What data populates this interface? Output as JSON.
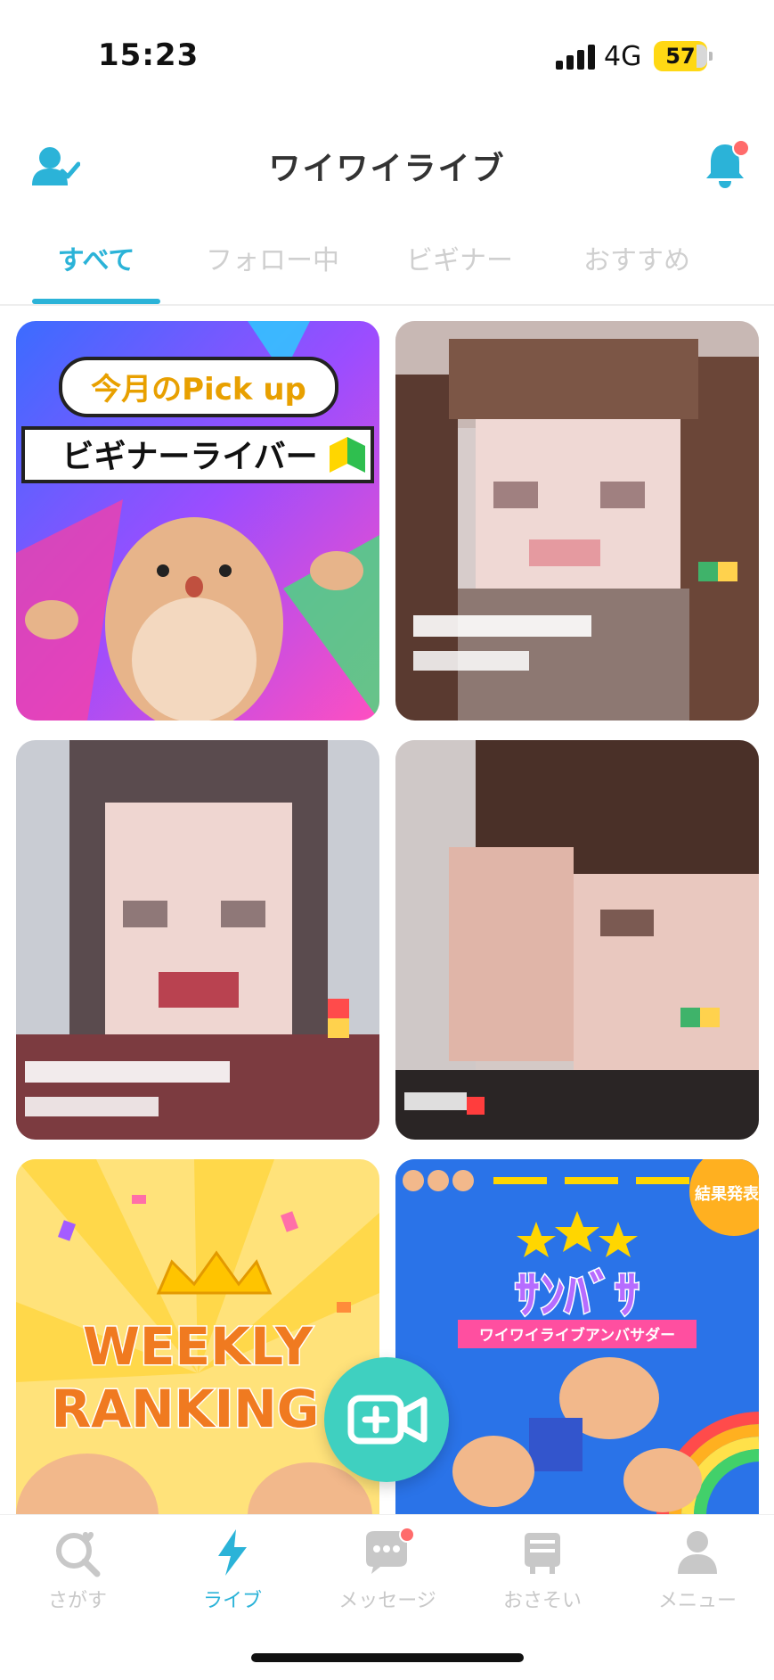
{
  "status_bar": {
    "time": "15:23",
    "network": "4G",
    "battery": "57"
  },
  "header": {
    "title": "ワイワイライブ",
    "left_icon": "user-check-icon",
    "right_icon": "bell-icon"
  },
  "tabs": [
    {
      "label": "すべて",
      "active": true
    },
    {
      "label": "フォロー中",
      "active": false
    },
    {
      "label": "ビギナー",
      "active": false
    },
    {
      "label": "おすすめ",
      "active": false
    }
  ],
  "grid": {
    "banner_pickup": {
      "line1": "今月のPick up",
      "line2": "ビギナーライバー"
    },
    "banner_weekly": {
      "line1": "WEEKLY",
      "line2": "RANKING"
    },
    "banner_ambassador": {
      "title": "ｻﾝﾊﾞｻ",
      "subtitle": "ワイワイライブアンバサダー",
      "badge": "結果発表"
    }
  },
  "fab": {
    "icon": "video-plus-icon"
  },
  "bottom_nav": [
    {
      "label": "さがす",
      "icon": "search-heart-icon",
      "active": false
    },
    {
      "label": "ライブ",
      "icon": "lightning-icon",
      "active": true
    },
    {
      "label": "メッセージ",
      "icon": "chat-icon",
      "active": false
    },
    {
      "label": "おさそい",
      "icon": "invite-board-icon",
      "active": false
    },
    {
      "label": "メニュー",
      "icon": "person-icon",
      "active": false
    }
  ],
  "colors": {
    "accent": "#2bb3d8",
    "fab": "#3fd0c0",
    "notify": "#ff6b6b",
    "tab_inactive": "#cfcfcf"
  }
}
